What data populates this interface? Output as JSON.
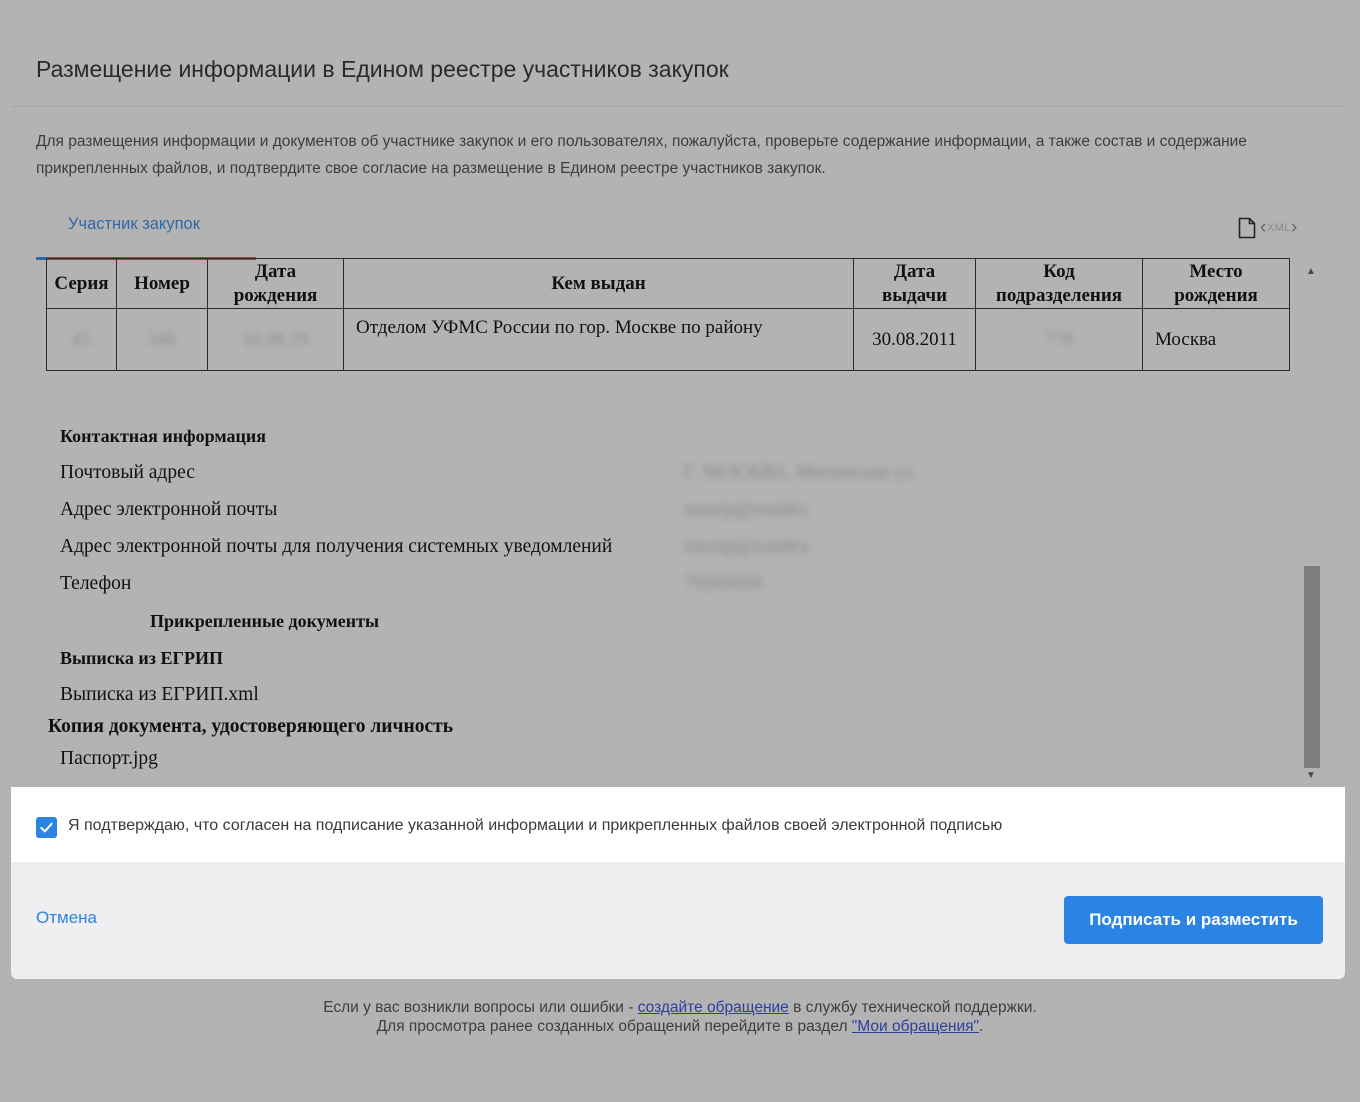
{
  "dialog": {
    "title": "Размещение информации в Едином реестре участников закупок",
    "intro": "Для размещения информации и документов об участнике закупок и его пользователях, пожалуйста, проверьте содержание информации, а также состав и содержание прикрепленных файлов, и подтвердите свое согласие на размещение в Едином реестре участников закупок.",
    "tab_label": "Участник закупок",
    "xml_label": "XML"
  },
  "passport_table": {
    "headers": {
      "series": "Серия",
      "number": "Номер",
      "birth_date_1": "Дата",
      "birth_date_2": "рождения",
      "issued_by": "Кем выдан",
      "issue_date_1": "Дата",
      "issue_date_2": "выдачи",
      "division_code_1": "Код",
      "division_code_2": "подразделения",
      "birth_place_1": "Место",
      "birth_place_2": "рождения"
    },
    "row": {
      "series": "45",
      "number": "346",
      "birth_date": "16.08.19",
      "issued_by": "Отделом УФМС России по гор. Москве по району",
      "issue_date": "30.08.2011",
      "division_code": "770",
      "birth_place": "Москва"
    }
  },
  "contact": {
    "heading": "Контактная информация",
    "postal_label": "Почтовый адрес",
    "postal_value": "Г. МОСКВА, Митинская ул.",
    "email_label": "Адрес электронной почты",
    "email_value": "nazaip@yandex",
    "notify_email_label": "Адрес электронной почты для получения системных уведомлений",
    "notify_email_value": "nazaip@yandex",
    "phone_label": "Телефон",
    "phone_value": "79265058"
  },
  "attachments": {
    "heading": "Прикрепленные документы",
    "egrip_heading": "Выписка из ЕГРИП",
    "egrip_file": "Выписка из ЕГРИП.xml",
    "id_heading": "Копия документа, удостоверяющего личность",
    "id_file": "Паспорт.jpg"
  },
  "confirm": {
    "checked": true,
    "text": "Я подтверждаю, что согласен на подписание указанной информации и прикрепленных файлов своей электронной подписью"
  },
  "actions": {
    "cancel": "Отмена",
    "submit": "Подписать и разместить"
  },
  "footer": {
    "line1_pre": "Если у вас возникли вопросы или ошибки - ",
    "line1_link": "создайте обращение",
    "line1_post": " в службу технической поддержки.",
    "line2_pre": "Для просмотра ранее созданных обращений перейдите в раздел ",
    "line2_link": "\"Мои обращения\"",
    "line2_post": "."
  },
  "colors": {
    "accent": "#2b84e3",
    "overlay": "#b3b3b3",
    "panel": "#efeff1"
  }
}
